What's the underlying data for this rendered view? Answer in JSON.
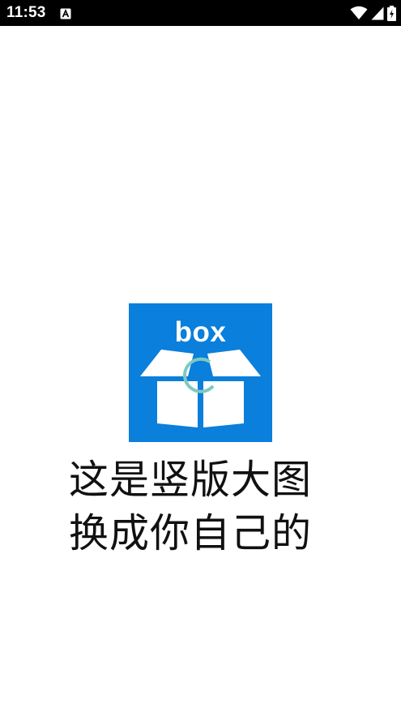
{
  "status_bar": {
    "time": "11:53",
    "notification_icon": "a-accessibility-icon",
    "wifi_icon": "wifi-icon",
    "signal_icon": "cell-signal-icon",
    "battery_icon": "battery-charging-icon"
  },
  "splash": {
    "logo_text": "box",
    "logo_color": "#0a7fdc",
    "slogan_line1": "这是竖版大图",
    "slogan_line2": "换成你自己的"
  },
  "spinner": {
    "icon": "loading-spinner-icon",
    "color": "#7ec9c0"
  }
}
